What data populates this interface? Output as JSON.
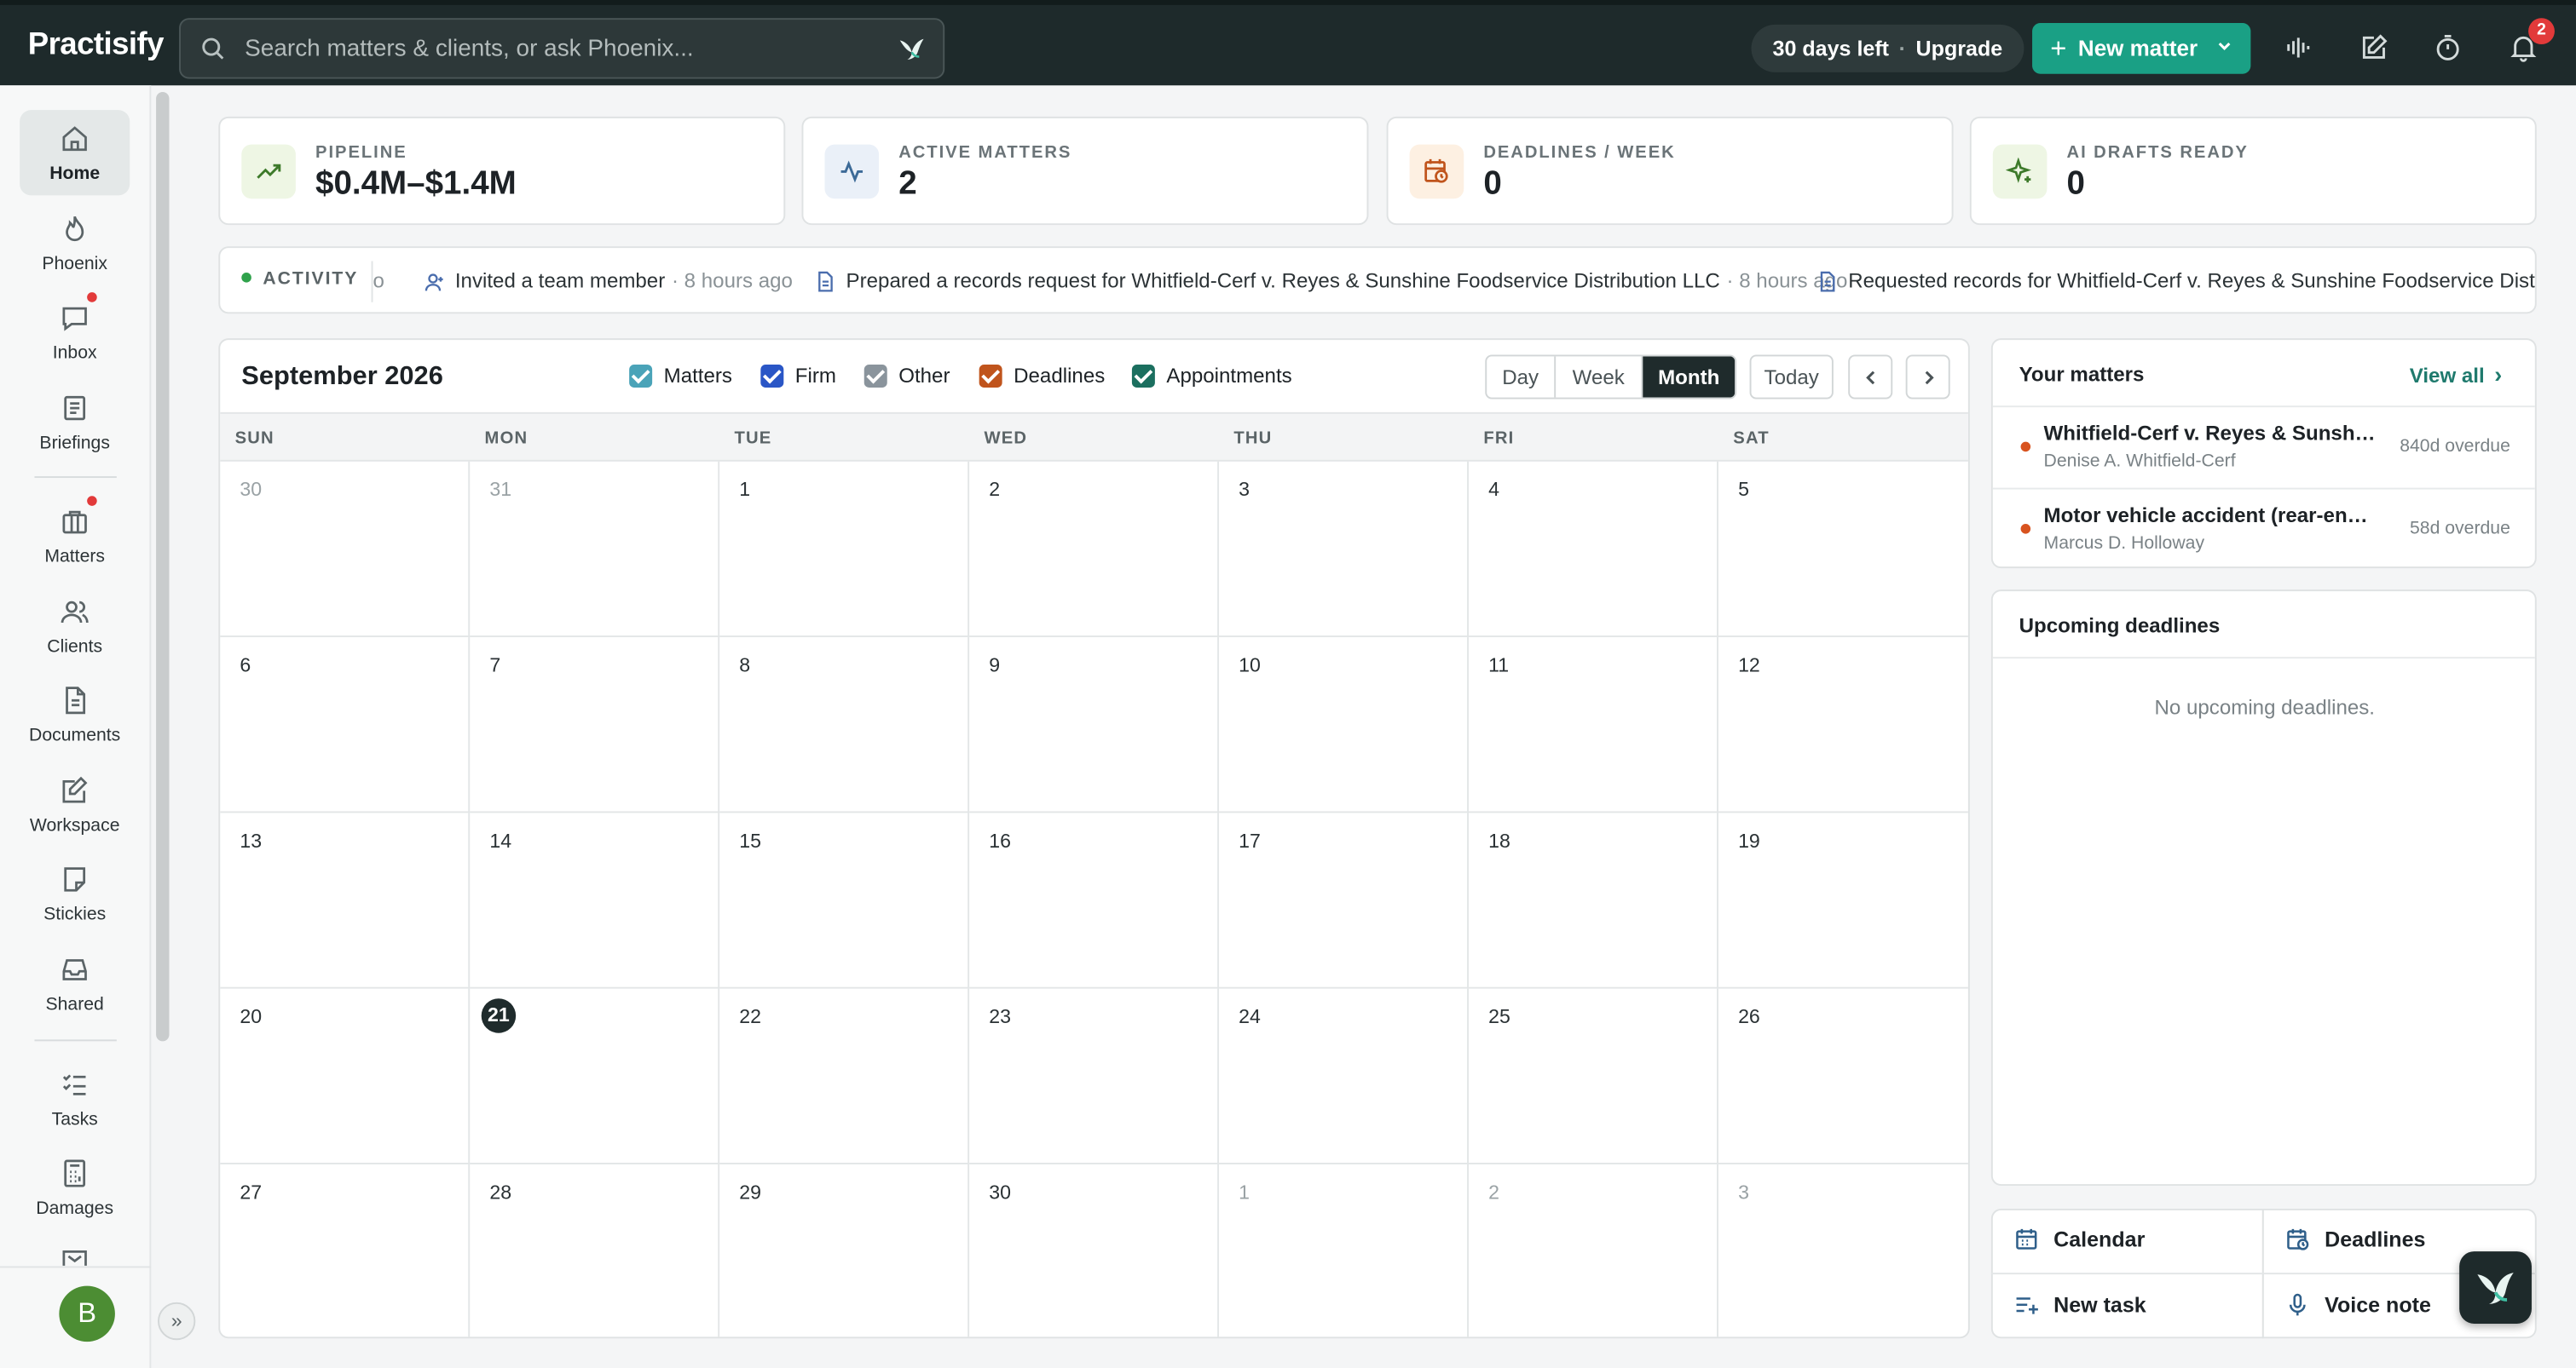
{
  "app": {
    "name": "Practisify"
  },
  "search": {
    "placeholder": "Search matters & clients, or ask Phoenix..."
  },
  "topbar": {
    "trial_days": "30 days left",
    "upgrade": "Upgrade",
    "new_matter": "New matter",
    "notification_count": "2"
  },
  "sidebar": {
    "items": [
      {
        "label": "Home"
      },
      {
        "label": "Phoenix"
      },
      {
        "label": "Inbox"
      },
      {
        "label": "Briefings"
      },
      {
        "label": "Matters"
      },
      {
        "label": "Clients"
      },
      {
        "label": "Documents"
      },
      {
        "label": "Workspace"
      },
      {
        "label": "Stickies"
      },
      {
        "label": "Shared"
      },
      {
        "label": "Tasks"
      },
      {
        "label": "Damages"
      }
    ],
    "avatar_initial": "B"
  },
  "stats": [
    {
      "label": "PIPELINE",
      "value": "$0.4M–$1.4M"
    },
    {
      "label": "ACTIVE MATTERS",
      "value": "2"
    },
    {
      "label": "DEADLINES / WEEK",
      "value": "0"
    },
    {
      "label": "AI DRAFTS READY",
      "value": "0"
    }
  ],
  "activity": {
    "label": "ACTIVITY",
    "fragment": "o",
    "items": [
      {
        "text": "Invited a team member",
        "time": "· 8 hours ago"
      },
      {
        "text": "Prepared a records request for Whitfield-Cerf v. Reyes & Sunshine Foodservice Distribution LLC",
        "time": "· 8 hours ago"
      },
      {
        "text": "Requested records for Whitfield-Cerf v. Reyes & Sunshine Foodservice Distribution LLC",
        "time": ""
      }
    ]
  },
  "calendar": {
    "title": "September 2026",
    "filters": [
      {
        "label": "Matters",
        "color": "#4aa3b8"
      },
      {
        "label": "Firm",
        "color": "#2a56c6"
      },
      {
        "label": "Other",
        "color": "#8a949c"
      },
      {
        "label": "Deadlines",
        "color": "#c0541c"
      },
      {
        "label": "Appointments",
        "color": "#1b6f5f"
      }
    ],
    "views": [
      "Day",
      "Week",
      "Month"
    ],
    "active_view": "Month",
    "today_label": "Today",
    "weekdays": [
      "SUN",
      "MON",
      "TUE",
      "WED",
      "THU",
      "FRI",
      "SAT"
    ],
    "weeks": [
      [
        "30",
        "31",
        "1",
        "2",
        "3",
        "4",
        "5"
      ],
      [
        "6",
        "7",
        "8",
        "9",
        "10",
        "11",
        "12"
      ],
      [
        "13",
        "14",
        "15",
        "16",
        "17",
        "18",
        "19"
      ],
      [
        "20",
        "21",
        "22",
        "23",
        "24",
        "25",
        "26"
      ],
      [
        "27",
        "28",
        "29",
        "30",
        "1",
        "2",
        "3"
      ]
    ],
    "today": "21"
  },
  "your_matters": {
    "title": "Your matters",
    "view_all": "View all",
    "items": [
      {
        "name": "Whitfield-Cerf v. Reyes & Sunshine Foodservice Distribution LLC",
        "client": "Denise A. Whitfield-Cerf",
        "status": "840d overdue"
      },
      {
        "name": "Motor vehicle accident (rear-end collision)",
        "client": "Marcus D. Holloway",
        "status": "58d overdue"
      }
    ]
  },
  "deadlines": {
    "title": "Upcoming deadlines",
    "empty": "No upcoming deadlines."
  },
  "quick_actions": [
    {
      "label": "Calendar",
      "icon": "calendar-icon"
    },
    {
      "label": "Deadlines",
      "icon": "deadline-clock-icon"
    },
    {
      "label": "New task",
      "icon": "task-add-icon"
    },
    {
      "label": "Voice note",
      "icon": "microphone-icon"
    }
  ]
}
